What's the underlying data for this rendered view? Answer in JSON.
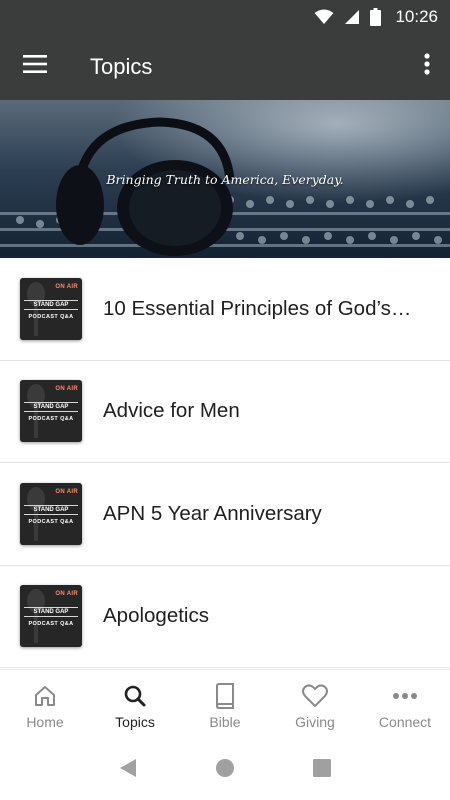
{
  "status_bar": {
    "time": "10:26",
    "icons": [
      "wifi-icon",
      "signal-icon",
      "battery-icon"
    ]
  },
  "app_bar": {
    "title": "Topics",
    "menu_icon": "hamburger-menu-icon",
    "more_icon": "more-vert-icon"
  },
  "banner": {
    "tagline": "Bringing Truth to America, Everyday."
  },
  "topics": [
    {
      "title": "10 Essential Principles of God’s…",
      "thumb_top": "STAND GAP",
      "thumb_bottom": "PODCAST Q&A",
      "thumb_badge": "ON AIR"
    },
    {
      "title": "Advice for Men",
      "thumb_top": "STAND GAP",
      "thumb_bottom": "PODCAST Q&A",
      "thumb_badge": "ON AIR"
    },
    {
      "title": "APN 5 Year Anniversary",
      "thumb_top": "STAND GAP",
      "thumb_bottom": "PODCAST Q&A",
      "thumb_badge": "ON AIR"
    },
    {
      "title": "Apologetics",
      "thumb_top": "STAND GAP",
      "thumb_bottom": "PODCAST Q&A",
      "thumb_badge": "ON AIR"
    }
  ],
  "bottom_nav": [
    {
      "label": "Home",
      "icon": "home-icon",
      "active": false
    },
    {
      "label": "Topics",
      "icon": "search-icon",
      "active": true
    },
    {
      "label": "Bible",
      "icon": "book-icon",
      "active": false
    },
    {
      "label": "Giving",
      "icon": "heart-icon",
      "active": false
    },
    {
      "label": "Connect",
      "icon": "more-horiz-icon",
      "active": false
    }
  ],
  "system_nav": [
    "back-icon",
    "home-circle-icon",
    "recents-icon"
  ],
  "colors": {
    "app_bar": "#3b3d3d",
    "active_nav": "#222222",
    "inactive_nav": "#8a8a8a"
  }
}
